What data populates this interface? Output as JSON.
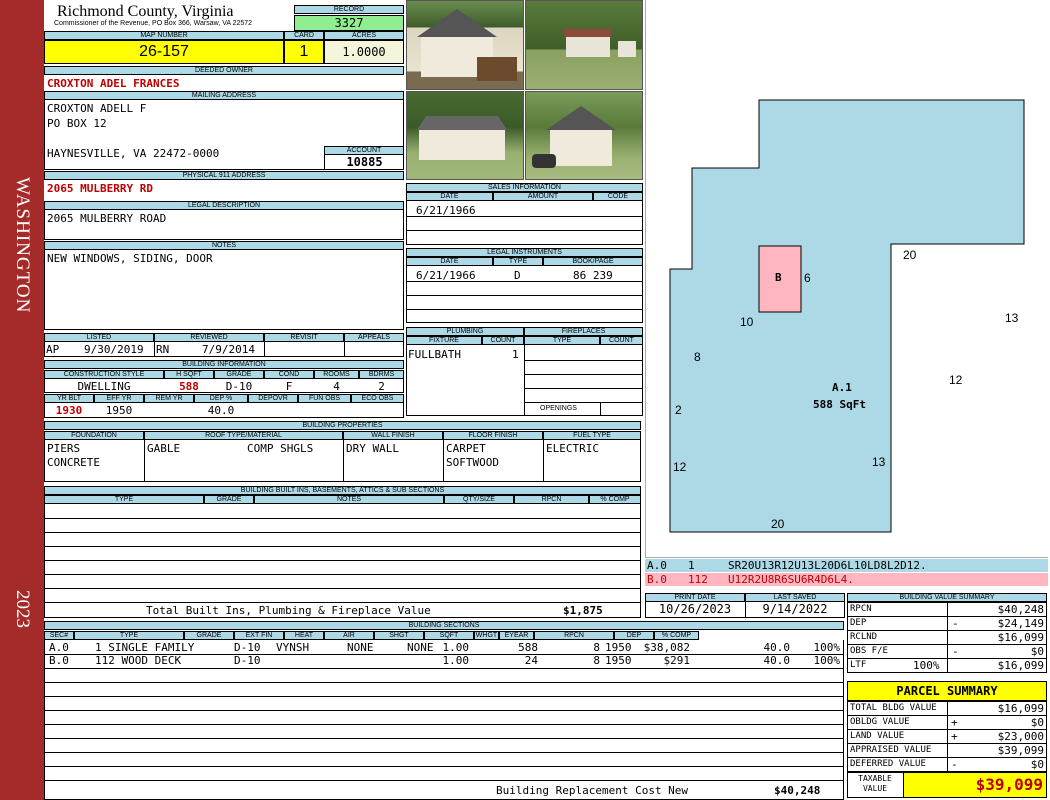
{
  "band": {
    "title": "WASHINGTON",
    "year": "2023"
  },
  "header": {
    "county": "Richmond County, Virginia",
    "commissioner": "Commissioner of the Revenue, PO Box 366, Warsaw, VA 22572",
    "record_label": "RECORD",
    "record": "3327"
  },
  "map": {
    "map_label": "MAP NUMBER",
    "map_number": "26-157",
    "card_label": "CARD",
    "card": "1",
    "acres_label": "ACRES",
    "acres": "1.0000"
  },
  "owner": {
    "label": "DEEDED OWNER",
    "name": "CROXTON ADEL FRANCES"
  },
  "mailing": {
    "label": "MAILING ADDRESS",
    "line1": "CROXTON ADELL F",
    "line2": "PO BOX 12",
    "line3": "HAYNESVILLE, VA 22472-0000",
    "account_label": "ACCOUNT",
    "account": "10885"
  },
  "physical": {
    "label": "PHYSICAL 911 ADDRESS",
    "address": "2065 MULBERRY RD"
  },
  "legal": {
    "label": "LEGAL DESCRIPTION",
    "text": "2065 MULBERRY ROAD"
  },
  "notes": {
    "label": "NOTES",
    "text": "NEW WINDOWS, SIDING, DOOR"
  },
  "status": {
    "listed_label": "LISTED",
    "reviewed_label": "REVIEWED",
    "revisit_label": "REVISIT",
    "appeals_label": "APPEALS",
    "listed_by": "AP",
    "listed_date": "9/30/2019",
    "reviewed_by": "RN",
    "reviewed_date": "7/9/2014"
  },
  "building_info": {
    "label": "BUILDING INFORMATION",
    "h1": [
      "CONSTRUCTION STYLE",
      "H SQFT",
      "GRADE",
      "COND",
      "ROOMS",
      "BDRMS"
    ],
    "v1": [
      "DWELLING",
      "588",
      "D-10",
      "F",
      "4",
      "2"
    ],
    "h2": [
      "YR BLT",
      "EFF YR",
      "REM YR",
      "DEP %",
      "DEPOVR",
      "FUN OBS",
      "ECO OBS"
    ],
    "v2": [
      "1930",
      "1950",
      "",
      "40.0",
      "",
      "",
      ""
    ]
  },
  "sales": {
    "label": "SALES INFORMATION",
    "cols": [
      "DATE",
      "AMOUNT",
      "CODE"
    ],
    "rows": [
      [
        "6/21/1966",
        "",
        ""
      ]
    ]
  },
  "instruments": {
    "label": "LEGAL INSTRUMENTS",
    "cols": [
      "DATE",
      "TYPE",
      "BOOK/PAGE"
    ],
    "rows": [
      [
        "6/21/1966",
        "D",
        "86 239"
      ]
    ]
  },
  "plumbing": {
    "label": "PLUMBING",
    "cols": [
      "FIXTURE",
      "COUNT"
    ],
    "rows": [
      [
        "FULLBATH",
        "1"
      ]
    ]
  },
  "fireplaces": {
    "label": "FIREPLACES",
    "cols": [
      "TYPE",
      "COUNT"
    ],
    "openings_label": "OPENINGS"
  },
  "properties": {
    "label": "BUILDING PROPERTIES",
    "cols": [
      "FOUNDATION",
      "ROOF TYPE/MATERIAL",
      "WALL FINISH",
      "FLOOR FINISH",
      "FUEL TYPE"
    ],
    "foundation": [
      "PIERS",
      "CONCRETE"
    ],
    "roof_type": "GABLE",
    "roof_material": "COMP SHGLS",
    "wall": "DRY WALL",
    "floor": [
      "CARPET",
      "SOFTWOOD"
    ],
    "fuel": "ELECTRIC"
  },
  "builtins": {
    "label": "BUILDING BUILT INS, BASEMENTS, ATTICS & SUB SECTIONS",
    "cols": [
      "TYPE",
      "GRADE",
      "NOTES",
      "QTY/SIZE",
      "RPCN",
      "% COMP"
    ],
    "total_label": "Total Built Ins, Plumbing & Fireplace Value",
    "total": "$1,875"
  },
  "print": {
    "print_label": "PRINT DATE",
    "saved_label": "LAST SAVED",
    "print_date": "10/26/2023",
    "saved_date": "9/14/2022"
  },
  "sketch": {
    "label_a": "A.1",
    "area_a": "588 SqFt",
    "label_b": "B",
    "dims": [
      "20",
      "6",
      "10",
      "13",
      "8",
      "12",
      "2",
      "13",
      "12",
      "20"
    ],
    "vectors": [
      {
        "code": "A.0",
        "num": "1",
        "vec": "SR20U13R12U13L20D6L10LD8L2D12."
      },
      {
        "code": "B.0",
        "num": "112",
        "vec": "U12R2U8R6SU6R4D6L4."
      }
    ]
  },
  "sections": {
    "label": "BUILDING SECTIONS",
    "cols": [
      "SEC#",
      "TYPE",
      "GRADE",
      "EXT FIN",
      "HEAT",
      "AIR",
      "SHGT",
      "SQFT",
      "WHGT",
      "EYEAR",
      "RPCN",
      "DEP",
      "% COMP"
    ],
    "rows": [
      [
        "A.0",
        "1 SINGLE FAMILY",
        "D-10",
        "VYNSH",
        "NONE",
        "NONE",
        "1.00",
        "588",
        "8",
        "1950",
        "$38,082",
        "40.0",
        "100%"
      ],
      [
        "B.0",
        "112 WOOD DECK",
        "D-10",
        "",
        "",
        "",
        "1.00",
        "24",
        "8",
        "1950",
        "$291",
        "40.0",
        "100%"
      ]
    ],
    "replacement_label": "Building Replacement Cost New",
    "replacement": "$40,248"
  },
  "value_summary": {
    "label": "BUILDING VALUE SUMMARY",
    "rows": [
      {
        "k": "RPCN",
        "s": "",
        "v": "$40,248"
      },
      {
        "k": "DEP",
        "s": "-",
        "v": "$24,149"
      },
      {
        "k": "RCLND",
        "s": "",
        "v": "$16,099"
      },
      {
        "k": "OBS F/E",
        "s": "-",
        "v": "$0"
      },
      {
        "k": "LTF",
        "p": "100%",
        "s": "",
        "v": "$16,099"
      }
    ]
  },
  "parcel": {
    "label": "PARCEL SUMMARY",
    "rows": [
      {
        "k": "TOTAL BLDG VALUE",
        "s": "",
        "v": "$16,099"
      },
      {
        "k": "OBLDG VALUE",
        "s": "+",
        "v": "$0"
      },
      {
        "k": "LAND VALUE",
        "s": "+",
        "v": "$23,000"
      },
      {
        "k": "APPRAISED VALUE",
        "s": "",
        "v": "$39,099"
      },
      {
        "k": "DEFERRED VALUE",
        "s": "-",
        "v": "$0"
      }
    ],
    "taxable_label1": "TAXABLE",
    "taxable_label2": "VALUE",
    "taxable": "$39,099"
  },
  "colors": {
    "band": "#a52a2a",
    "header": "#add8e6",
    "highlight": "#ffff00",
    "sketch_main": "#add8e6",
    "sketch_deck": "#ffb6c1",
    "record_bg": "#90ee90"
  }
}
